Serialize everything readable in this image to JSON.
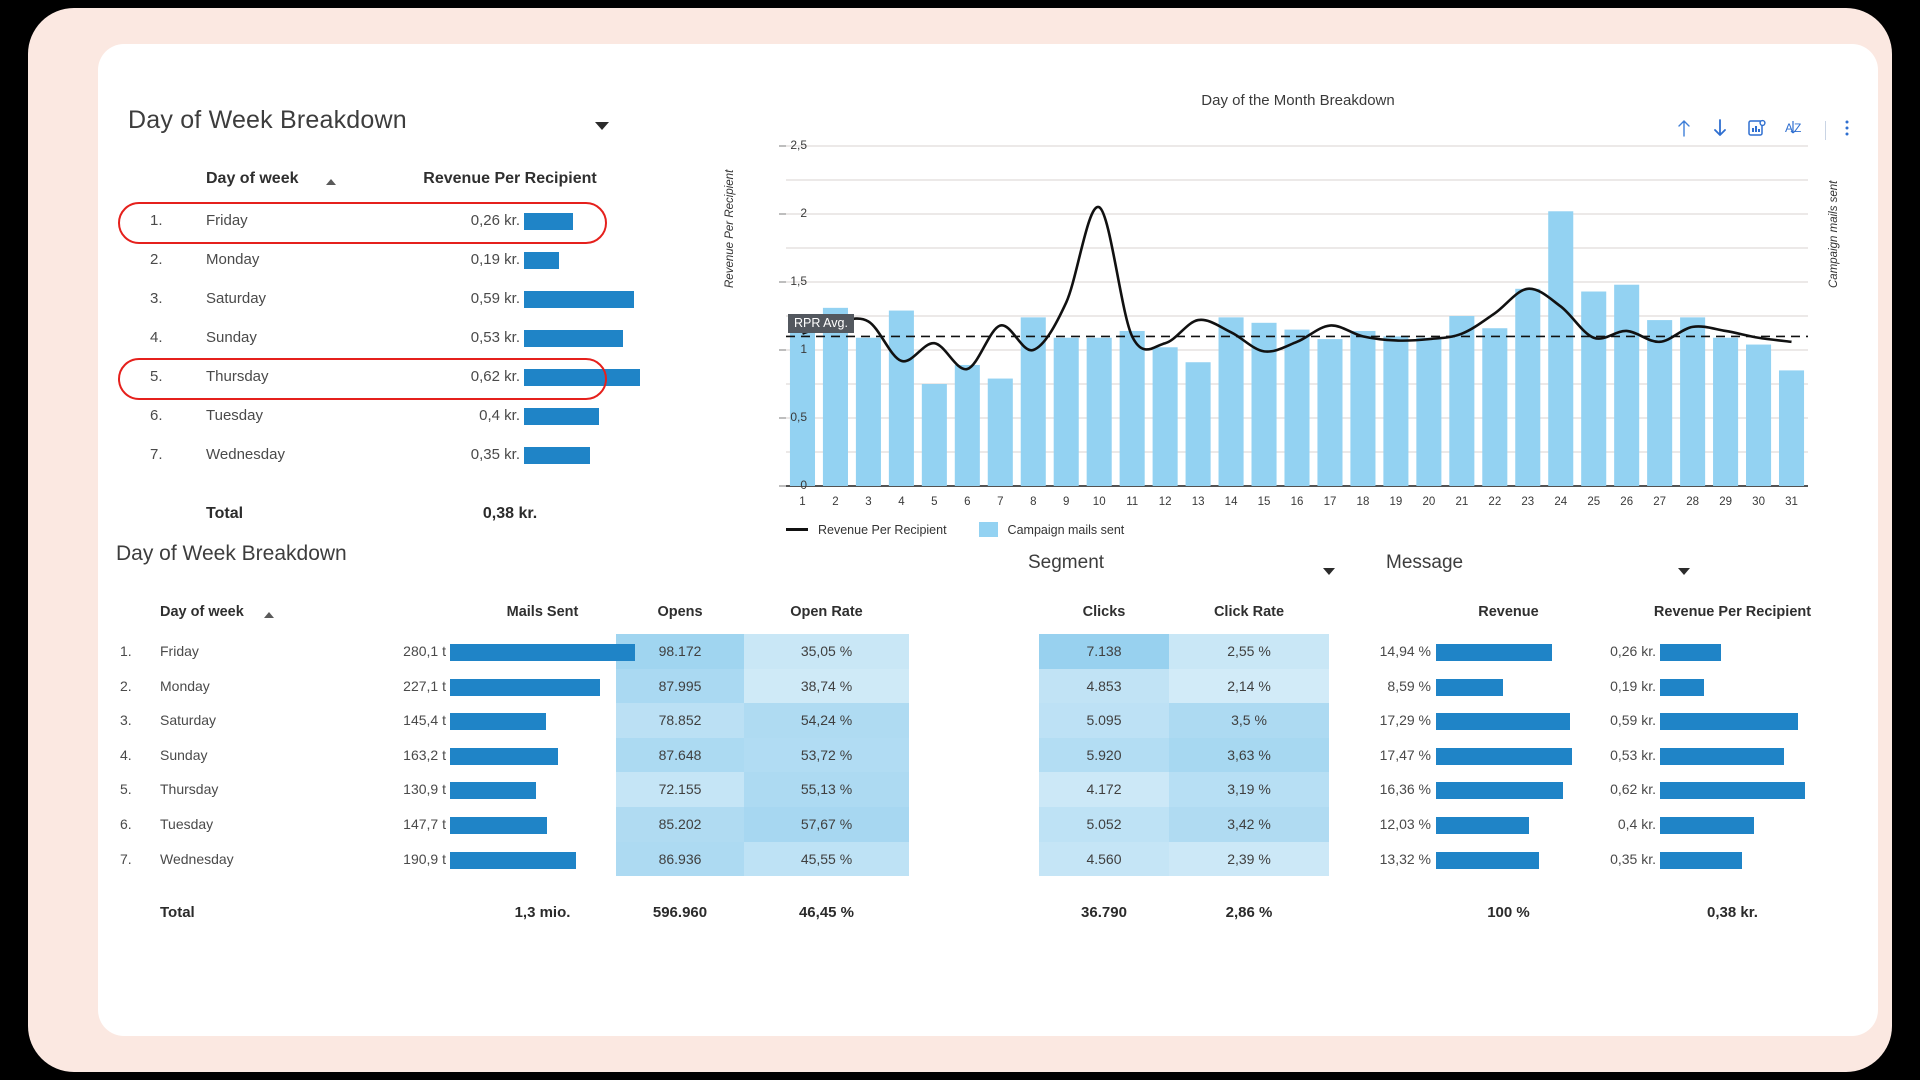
{
  "theme": {
    "page_bg": "#fbe8e1",
    "card_bg": "#ffffff",
    "bar_blue": "#1f84c7",
    "chart_bar_blue": "#93d2f2",
    "highlight_red": "#e5201c",
    "accent_icon": "#2f6fd0"
  },
  "top_left": {
    "title": "Day of Week Breakdown",
    "headers": {
      "day": "Day of week",
      "metric": "Revenue Per Recipient"
    },
    "rows": [
      {
        "index": "1.",
        "day": "Friday",
        "value": "0,26 kr.",
        "bar_pct": 41.9
      },
      {
        "index": "2.",
        "day": "Monday",
        "value": "0,19 kr.",
        "bar_pct": 30.6
      },
      {
        "index": "3.",
        "day": "Saturday",
        "value": "0,59 kr.",
        "bar_pct": 95.2
      },
      {
        "index": "4.",
        "day": "Sunday",
        "value": "0,53 kr.",
        "bar_pct": 85.5
      },
      {
        "index": "5.",
        "day": "Thursday",
        "value": "0,62 kr.",
        "bar_pct": 100.0
      },
      {
        "index": "6.",
        "day": "Tuesday",
        "value": "0,4 kr.",
        "bar_pct": 64.5
      },
      {
        "index": "7.",
        "day": "Wednesday",
        "value": "0,35 kr.",
        "bar_pct": 56.5
      }
    ],
    "highlighted_rows": [
      0,
      4
    ],
    "total_label": "Total",
    "total_value": "0,38 kr."
  },
  "chart_panel": {
    "title": "Day of the Month Breakdown",
    "tools": [
      {
        "name": "sort-ascending-icon",
        "label": "↑"
      },
      {
        "name": "sort-descending-icon",
        "label": "↓"
      },
      {
        "name": "chart-settings-icon",
        "label": "chart"
      },
      {
        "name": "sort-alpha-icon",
        "label": "AZ"
      },
      {
        "name": "more-options-icon",
        "label": "⋮"
      }
    ]
  },
  "chart_data": {
    "type": "bar",
    "title": "Day of the Month Breakdown",
    "xlabel": "",
    "ylabel": "Revenue Per Recipient",
    "y2label": "Campaign mails sent",
    "grid": true,
    "legend_position": "bottom-left",
    "yticks": [
      "0",
      "0,5",
      "1",
      "1,5",
      "2",
      "2,5"
    ],
    "ylim": [
      0,
      2.5
    ],
    "categories": [
      "1",
      "2",
      "3",
      "4",
      "5",
      "6",
      "7",
      "8",
      "9",
      "10",
      "11",
      "12",
      "13",
      "14",
      "15",
      "16",
      "17",
      "18",
      "19",
      "20",
      "21",
      "22",
      "23",
      "24",
      "25",
      "26",
      "27",
      "28",
      "29",
      "30",
      "31"
    ],
    "series": [
      {
        "name": "Campaign mails sent",
        "type": "bar",
        "color": "#93d2f2",
        "values": [
          1.18,
          1.31,
          1.09,
          1.29,
          0.75,
          0.89,
          0.79,
          1.24,
          1.09,
          1.09,
          1.14,
          1.02,
          0.91,
          1.24,
          1.2,
          1.15,
          1.08,
          1.14,
          1.1,
          1.09,
          1.25,
          1.16,
          1.45,
          2.02,
          1.43,
          1.48,
          1.22,
          1.24,
          1.09,
          1.04,
          0.85
        ]
      },
      {
        "name": "Revenue Per Recipient",
        "type": "line",
        "color": "#111111",
        "values": [
          1.12,
          1.2,
          1.21,
          0.92,
          1.05,
          0.86,
          1.18,
          1.0,
          1.35,
          2.05,
          1.1,
          1.05,
          1.22,
          1.13,
          0.99,
          1.06,
          1.18,
          1.1,
          1.07,
          1.08,
          1.12,
          1.27,
          1.45,
          1.32,
          1.09,
          1.14,
          1.06,
          1.17,
          1.14,
          1.09,
          1.06
        ]
      }
    ],
    "reference_line": {
      "label": "RPR Avg.",
      "value": 1.1,
      "style": "dashed"
    }
  },
  "bottom": {
    "title": "Day of Week Breakdown",
    "filters": [
      {
        "name": "segment",
        "label": "Segment"
      },
      {
        "name": "message",
        "label": "Message"
      }
    ],
    "headers": [
      "Day of week",
      "Mails Sent",
      "Opens",
      "Open Rate",
      "Clicks",
      "Click Rate",
      "Revenue",
      "Revenue Per Recipient"
    ],
    "rows": [
      {
        "index": "1.",
        "day": "Friday",
        "mails_sent": "280,1 t",
        "mails_pct": 100.0,
        "opens": "98.172",
        "opens_shade": 0.62,
        "open_rate": "35,05 %",
        "open_rate_shade": 0.22,
        "clicks": "7.138",
        "clicks_shade": 0.7,
        "click_rate": "2,55 %",
        "click_rate_shade": 0.22,
        "revenue": "14,94 %",
        "revenue_pct": 80.0,
        "rpr": "0,26 kr.",
        "rpr_pct": 41.9
      },
      {
        "index": "2.",
        "day": "Monday",
        "mails_sent": "227,1 t",
        "mails_pct": 81.0,
        "opens": "87.995",
        "opens_shade": 0.52,
        "open_rate": "38,74 %",
        "open_rate_shade": 0.16,
        "clicks": "4.853",
        "clicks_shade": 0.3,
        "click_rate": "2,14 %",
        "click_rate_shade": 0.14,
        "revenue": "8,59 %",
        "revenue_pct": 46.0,
        "rpr": "0,19 kr.",
        "rpr_pct": 30.6
      },
      {
        "index": "3.",
        "day": "Saturday",
        "mails_sent": "145,4 t",
        "mails_pct": 51.9,
        "opens": "78.852",
        "opens_shade": 0.36,
        "open_rate": "54,24 %",
        "open_rate_shade": 0.48,
        "clicks": "5.095",
        "clicks_shade": 0.34,
        "click_rate": "3,5 %",
        "click_rate_shade": 0.5,
        "revenue": "17,29 %",
        "revenue_pct": 92.6,
        "rpr": "0,59 kr.",
        "rpr_pct": 95.2
      },
      {
        "index": "4.",
        "day": "Sunday",
        "mails_sent": "163,2 t",
        "mails_pct": 58.3,
        "opens": "87.648",
        "opens_shade": 0.51,
        "open_rate": "53,72 %",
        "open_rate_shade": 0.46,
        "clicks": "5.920",
        "clicks_shade": 0.44,
        "click_rate": "3,63 %",
        "click_rate_shade": 0.55,
        "revenue": "17,47 %",
        "revenue_pct": 93.6,
        "rpr": "0,53 kr.",
        "rpr_pct": 85.5
      },
      {
        "index": "5.",
        "day": "Thursday",
        "mails_sent": "130,9 t",
        "mails_pct": 46.7,
        "opens": "72.155",
        "opens_shade": 0.26,
        "open_rate": "55,13 %",
        "open_rate_shade": 0.5,
        "clicks": "4.172",
        "clicks_shade": 0.2,
        "click_rate": "3,19 %",
        "click_rate_shade": 0.4,
        "revenue": "16,36 %",
        "revenue_pct": 87.6,
        "rpr": "0,62 kr.",
        "rpr_pct": 100.0
      },
      {
        "index": "6.",
        "day": "Tuesday",
        "mails_sent": "147,7 t",
        "mails_pct": 52.7,
        "opens": "85.202",
        "opens_shade": 0.47,
        "open_rate": "57,67 %",
        "open_rate_shade": 0.56,
        "clicks": "5.052",
        "clicks_shade": 0.33,
        "click_rate": "3,42 %",
        "click_rate_shade": 0.47,
        "revenue": "12,03 %",
        "revenue_pct": 64.4,
        "rpr": "0,4 kr.",
        "rpr_pct": 64.5
      },
      {
        "index": "7.",
        "day": "Wednesday",
        "mails_sent": "190,9 t",
        "mails_pct": 68.1,
        "opens": "86.936",
        "opens_shade": 0.5,
        "open_rate": "45,55 %",
        "open_rate_shade": 0.33,
        "clicks": "4.560",
        "clicks_shade": 0.26,
        "click_rate": "2,39 %",
        "click_rate_shade": 0.19,
        "revenue": "13,32 %",
        "revenue_pct": 71.3,
        "rpr": "0,35 kr.",
        "rpr_pct": 56.5
      }
    ],
    "totals": {
      "label": "Total",
      "mails_sent": "1,3 mio.",
      "opens": "596.960",
      "open_rate": "46,45 %",
      "clicks": "36.790",
      "click_rate": "2,86 %",
      "revenue": "100 %",
      "rpr": "0,38 kr."
    }
  }
}
